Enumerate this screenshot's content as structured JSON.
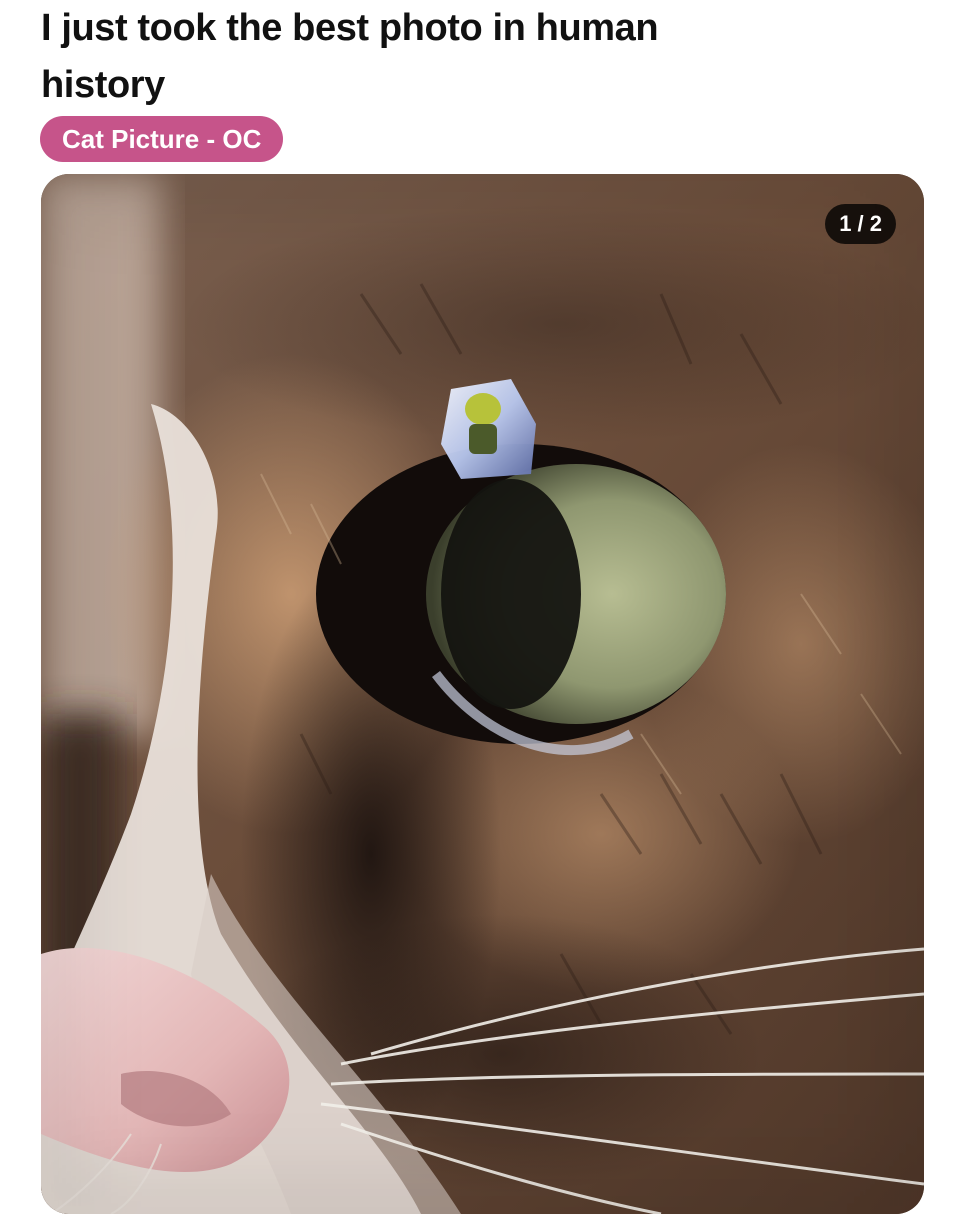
{
  "post": {
    "title": "I just took the best photo in human history",
    "flair": "Cat Picture - OC",
    "flair_color": "#c6548a"
  },
  "gallery": {
    "counter": "1 / 2",
    "current": 1,
    "total": 2,
    "image_icon": "cat-eye-closeup-photo"
  }
}
